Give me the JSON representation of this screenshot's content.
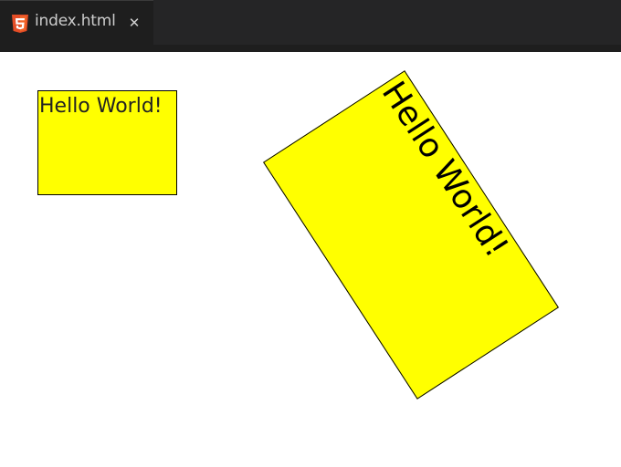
{
  "editor": {
    "tab": {
      "icon": "html5-icon",
      "file_name": "index.html",
      "close_icon": "close-icon",
      "close_glyph": "✕"
    }
  },
  "preview": {
    "plain_box": {
      "text": "Hello World!",
      "background": "#ffff00"
    },
    "rotated_box": {
      "text": "Hello World!",
      "background": "#ffff00"
    }
  }
}
